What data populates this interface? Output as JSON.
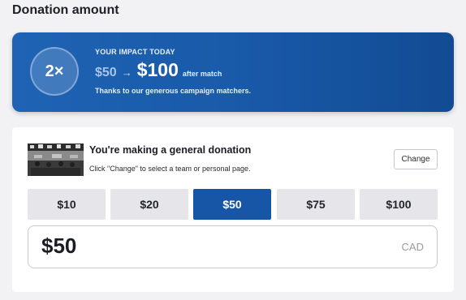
{
  "section": {
    "title": "Donation amount"
  },
  "impact": {
    "multiplier": "2×",
    "label": "YOUR IMPACT TODAY",
    "amount_before": "$50",
    "arrow": "→",
    "amount_after": "$100",
    "after_match": "after match",
    "thanks": "Thanks to our generous campaign matchers."
  },
  "general": {
    "title": "You're making a general donation",
    "subtitle": "Click \"Change\" to select a team or personal page.",
    "change_label": "Change"
  },
  "amounts": [
    "$10",
    "$20",
    "$50",
    "$75",
    "$100"
  ],
  "selected_amount": "$50",
  "input": {
    "value": "$50",
    "currency": "CAD"
  },
  "colors": {
    "brand_blue": "#1755a6",
    "card_gradient_start": "#1f63b4",
    "card_gradient_end": "#124b93"
  }
}
